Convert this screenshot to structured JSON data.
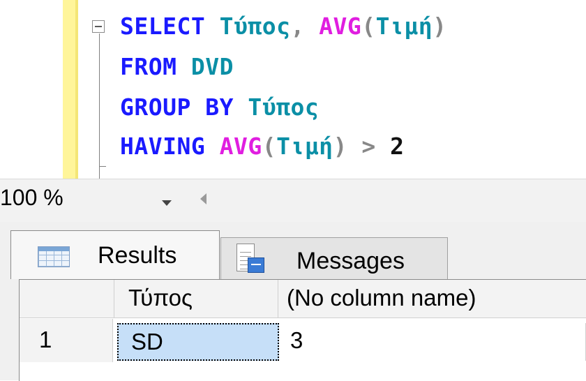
{
  "editor": {
    "lines": [
      {
        "kw1": "SELECT",
        "id1": "Τύπος",
        "p1": ",",
        "fn1": "AVG",
        "p2": "(",
        "id2": "Τιμή",
        "p3": ")"
      },
      {
        "kw1": "FROM",
        "id1": "DVD"
      },
      {
        "kw1": "GROUP",
        "kw2": "BY",
        "id1": "Τύπος"
      },
      {
        "kw1": "HAVING",
        "fn1": "AVG",
        "p1": "(",
        "id1": "Τιμή",
        "p2": ")",
        "op": ">",
        "num": "2"
      }
    ],
    "colors": {
      "keyword": "#1a1aff",
      "function": "#e01ee0",
      "identifier": "#0b8fa6",
      "operator": "#888888",
      "change_bar": "#fff59a"
    }
  },
  "zoom": {
    "value": "100 %"
  },
  "tabs": {
    "results": "Results",
    "messages": "Messages"
  },
  "grid": {
    "columns": [
      "Τύπος",
      "(No column name)"
    ],
    "rows": [
      {
        "num": "1",
        "cells": [
          "SD",
          "3"
        ]
      }
    ],
    "selection_color": "#c6dff8"
  }
}
